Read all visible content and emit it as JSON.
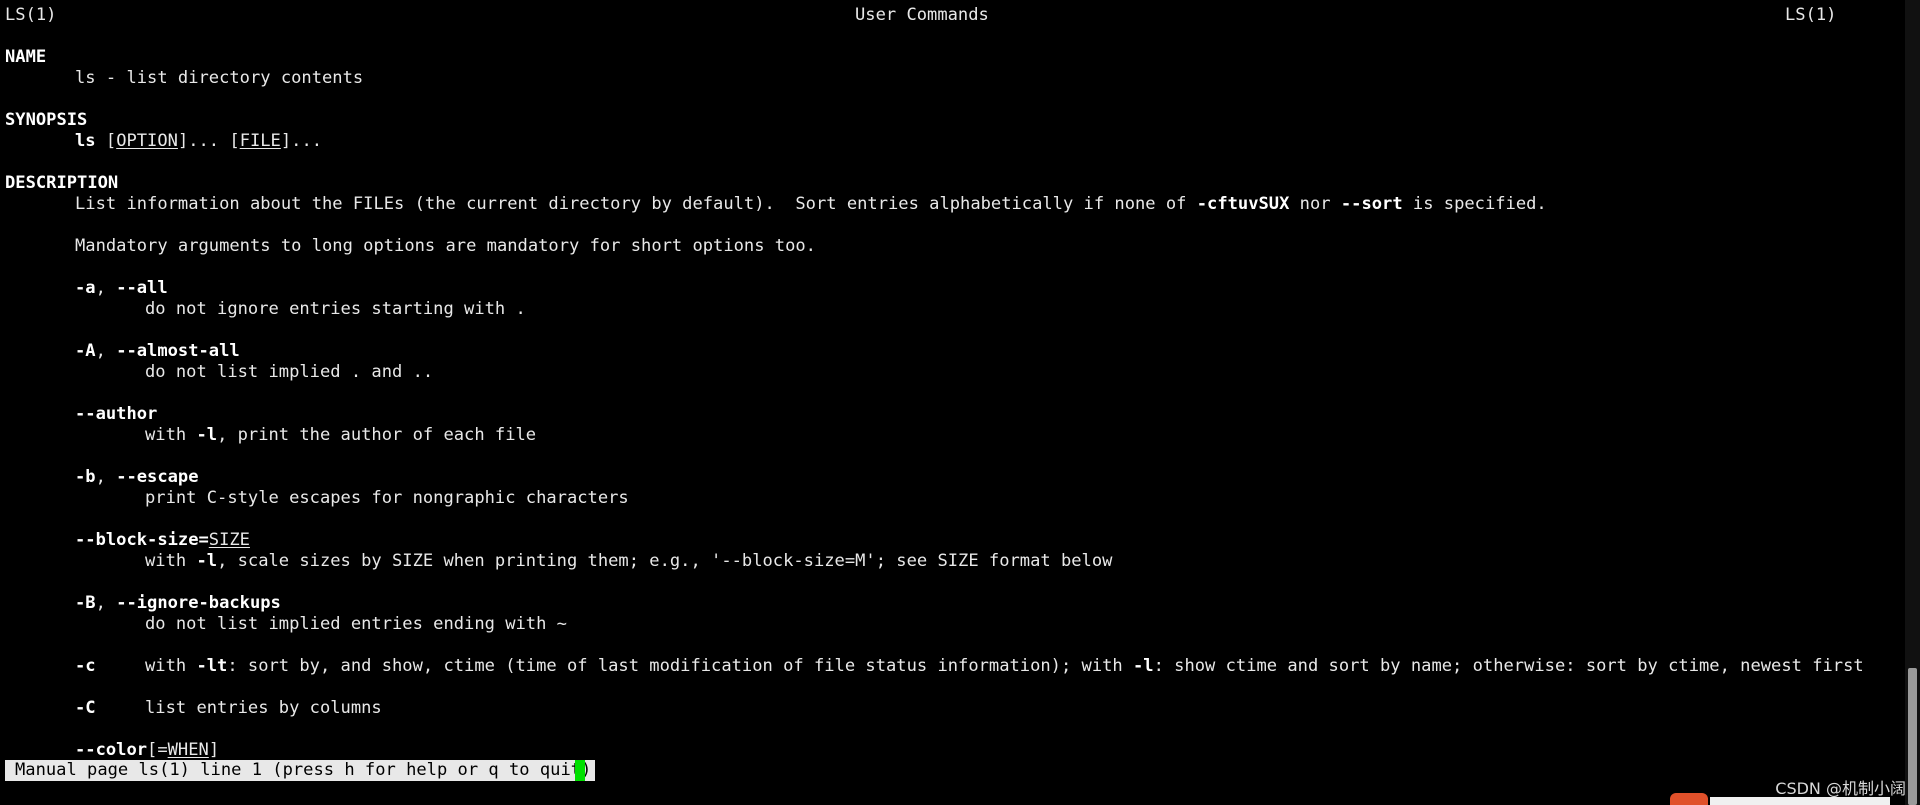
{
  "header": {
    "left": "LS(1)",
    "center": "User Commands",
    "right": "LS(1)"
  },
  "sections": {
    "name_heading": "NAME",
    "name_text": "ls - list directory contents",
    "synopsis_heading": "SYNOPSIS",
    "synopsis_cmd": "ls",
    "synopsis_open1": " [",
    "synopsis_option": "OPTION",
    "synopsis_mid": "]... [",
    "synopsis_file": "FILE",
    "synopsis_end": "]...",
    "description_heading": "DESCRIPTION",
    "desc_line1_a": "List information about the FILEs (the current directory by default).  Sort entries alphabetically if none of ",
    "desc_line1_b": "-cftuvSUX",
    "desc_line1_c": " nor ",
    "desc_line1_d": "--sort",
    "desc_line1_e": " is specified.",
    "desc_line2": "Mandatory arguments to long options are mandatory for short options too."
  },
  "options": {
    "a_flag": "-a",
    "a_sep": ", ",
    "a_long": "--all",
    "a_desc": "do not ignore entries starting with .",
    "A_flag": "-A",
    "A_sep": ", ",
    "A_long": "--almost-all",
    "A_desc": "do not list implied . and ..",
    "author_long": "--author",
    "author_desc_a": "with ",
    "author_desc_b": "-l",
    "author_desc_c": ", print the author of each file",
    "b_flag": "-b",
    "b_sep": ", ",
    "b_long": "--escape",
    "b_desc": "print C-style escapes for nongraphic characters",
    "bs_long": "--block-size=",
    "bs_arg": "SIZE",
    "bs_desc_a": "with ",
    "bs_desc_b": "-l",
    "bs_desc_c": ", scale sizes by SIZE when printing them; e.g., '--block-size=M'; see SIZE format below",
    "B_flag": "-B",
    "B_sep": ", ",
    "B_long": "--ignore-backups",
    "B_desc": "do not list implied entries ending with ~",
    "c_flag": "-c",
    "c_desc_a": "with ",
    "c_desc_b": "-lt",
    "c_desc_c": ": sort by, and show, ctime (time of last modification of file status information); with ",
    "c_desc_d": "-l",
    "c_desc_e": ": show ctime and sort by name; otherwise: sort by ctime, newest first",
    "C_flag": "-C",
    "C_desc": "list entries by columns",
    "color_long": "--color",
    "color_open": "[=",
    "color_arg": "WHEN",
    "color_close": "]"
  },
  "status": {
    "text": "Manual page ls(1) line 1 (press h for help or q to quit)"
  },
  "watermark": "CSDN @机制小阔",
  "colors": {
    "background": "#000000",
    "text": "#e8e8e8",
    "status_bg": "#e8e8e8",
    "cursor": "#00e000"
  }
}
